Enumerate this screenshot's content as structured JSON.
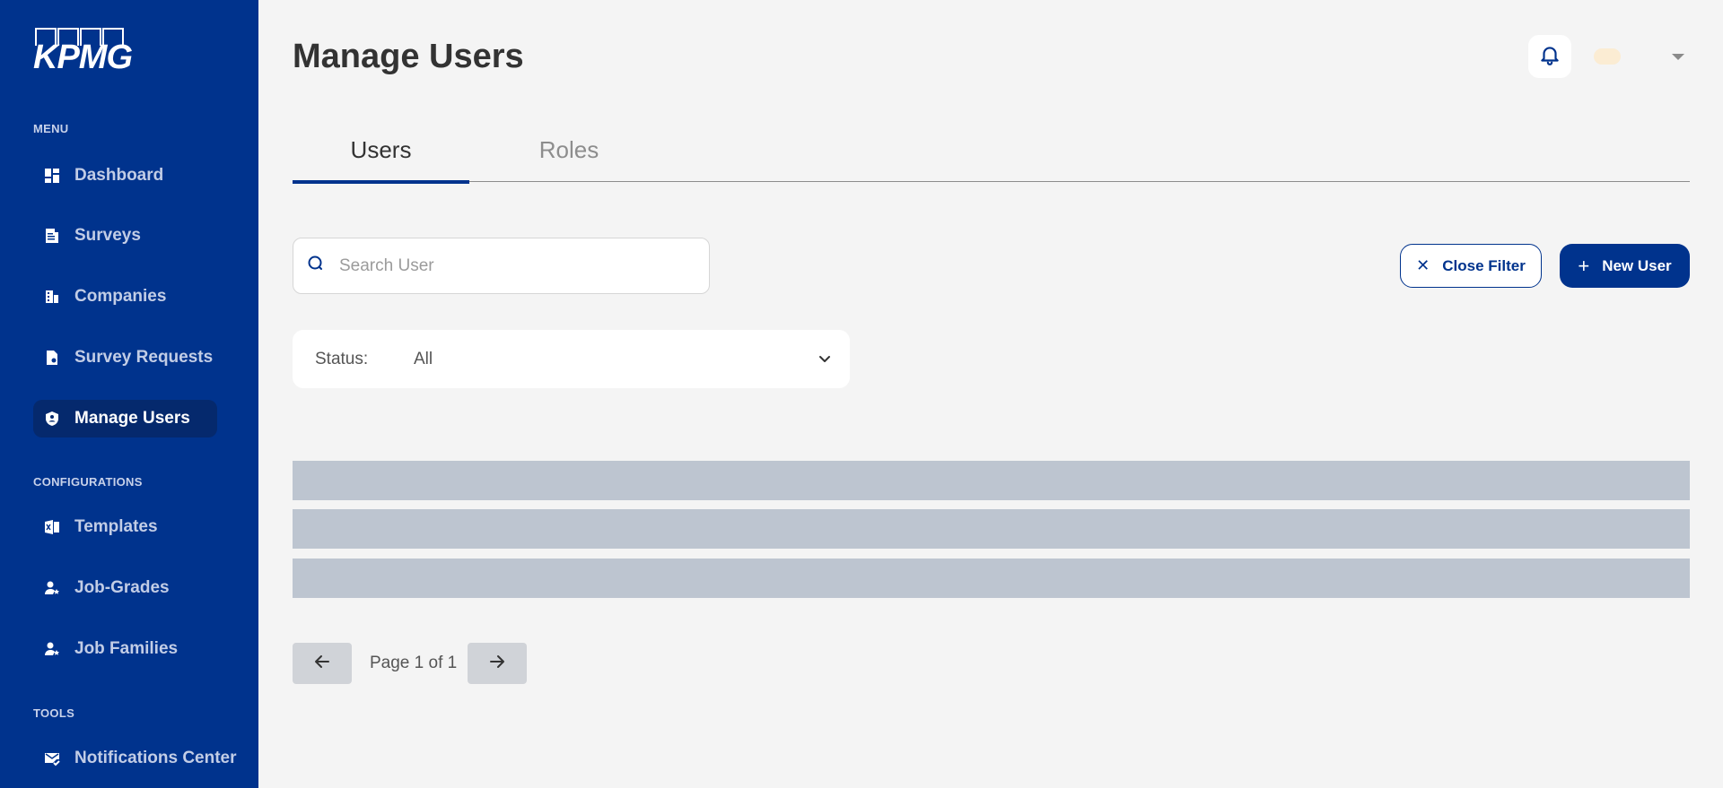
{
  "brand": {
    "logo_text": "KPMG"
  },
  "sidebar": {
    "sections": {
      "menu": "MENU",
      "configurations": "CONFIGURATIONS",
      "tools": "TOOLS"
    },
    "items": [
      {
        "label": "Dashboard",
        "icon": "dashboard-icon"
      },
      {
        "label": "Surveys",
        "icon": "survey-icon"
      },
      {
        "label": "Companies",
        "icon": "building-icon"
      },
      {
        "label": "Survey Requests",
        "icon": "document-icon"
      },
      {
        "label": "Manage Users",
        "icon": "shield-user-icon",
        "active": true
      },
      {
        "label": "Templates",
        "icon": "excel-icon"
      },
      {
        "label": "Job-Grades",
        "icon": "user-star-icon"
      },
      {
        "label": "Job Families",
        "icon": "user-star-icon"
      },
      {
        "label": "Notifications Center",
        "icon": "mail-check-icon"
      }
    ]
  },
  "header": {
    "title": "Manage Users"
  },
  "tabs": [
    {
      "label": "Users",
      "active": true
    },
    {
      "label": "Roles",
      "active": false
    }
  ],
  "search": {
    "placeholder": "Search User",
    "value": ""
  },
  "actions": {
    "close_filter": "Close Filter",
    "new_user": "New User"
  },
  "filter": {
    "status_label": "Status:",
    "status_value": "All"
  },
  "pagination": {
    "text": "Page 1 of 1"
  },
  "colors": {
    "brand": "#00338d",
    "skeleton": "#bdc5d0",
    "background": "#f4f4f4"
  }
}
